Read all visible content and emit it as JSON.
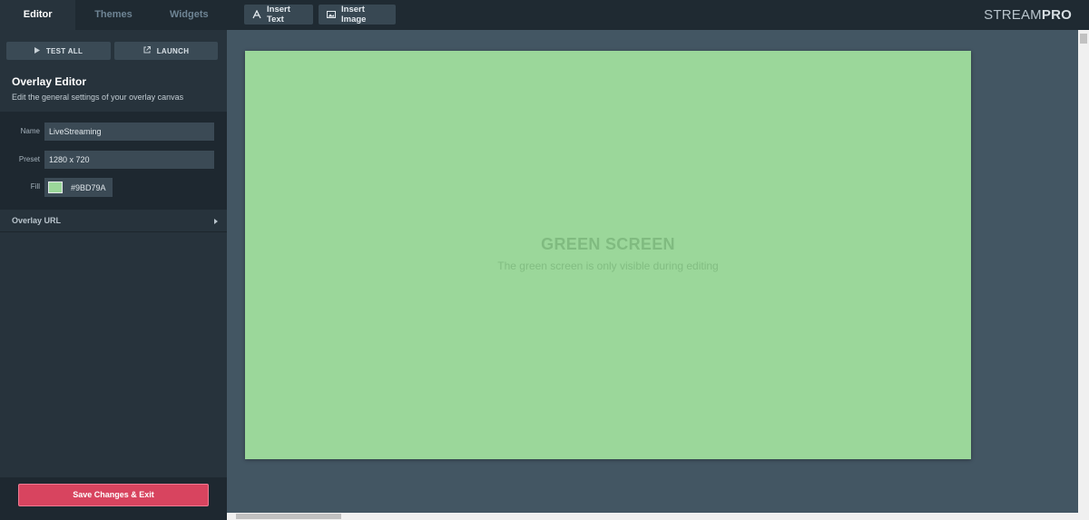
{
  "tabs": [
    {
      "label": "Editor",
      "active": true
    },
    {
      "label": "Themes",
      "active": false
    },
    {
      "label": "Widgets",
      "active": false
    }
  ],
  "toolbar": {
    "insert_text": "Insert Text",
    "insert_image": "Insert Image"
  },
  "brand": {
    "light": "STREAM",
    "bold": "PRO"
  },
  "sidebar": {
    "test_all": "TEST ALL",
    "launch": "LAUNCH",
    "title": "Overlay Editor",
    "subtitle": "Edit the general settings of your overlay canvas",
    "form": {
      "name_label": "Name",
      "name_value": "LiveStreaming",
      "preset_label": "Preset",
      "preset_value": "1280 x 720",
      "fill_label": "Fill",
      "fill_value": "#9BD79A"
    },
    "overlay_url": "Overlay URL",
    "save": "Save Changes & Exit"
  },
  "canvas": {
    "title": "GREEN SCREEN",
    "subtitle": "The green screen is only visible during editing"
  },
  "colors": {
    "topbar": "#1f2a32",
    "sidebar": "#27333c",
    "canvas_bg": "#435663",
    "green": "#9bd79a",
    "accent": "#d8445f"
  },
  "icons": {
    "test": "play-icon",
    "launch": "external-link-icon",
    "text": "text-icon",
    "image": "image-icon",
    "chevron": "chevron-right-icon"
  }
}
